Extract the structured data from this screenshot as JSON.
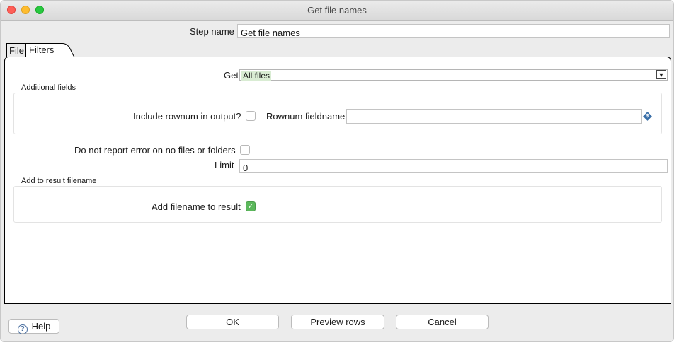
{
  "window": {
    "title": "Get file names"
  },
  "step": {
    "label": "Step name",
    "value": "Get file names"
  },
  "tabs": [
    {
      "label": "File"
    },
    {
      "label": "Filters"
    }
  ],
  "filters": {
    "get_label": "Get",
    "get_value": "All files",
    "additional_fields": {
      "title": "Additional fields",
      "include_rownum_label": "Include rownum in output?",
      "include_rownum_checked": false,
      "rownum_fieldname_label": "Rownum fieldname",
      "rownum_fieldname_value": ""
    },
    "no_error_label": "Do not report error on no files or folders",
    "no_error_checked": false,
    "limit_label": "Limit",
    "limit_value": "0",
    "add_to_result": {
      "title": "Add to result filename",
      "add_filename_label": "Add filename to result",
      "add_filename_checked": true
    }
  },
  "buttons": {
    "help": "Help",
    "ok": "OK",
    "preview": "Preview rows",
    "cancel": "Cancel"
  },
  "icons": {
    "variable": "variable-dollar-icon",
    "help": "question-circle-icon",
    "dropdown": "triangle-down-icon"
  }
}
